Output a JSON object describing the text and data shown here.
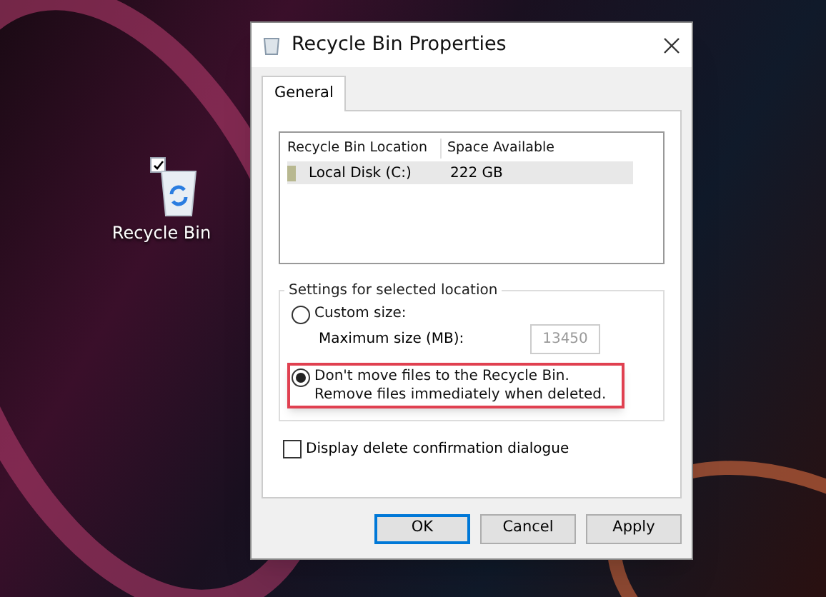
{
  "desktop_icon": {
    "label": "Recycle Bin",
    "checked": true
  },
  "window": {
    "title": "Recycle Bin Properties"
  },
  "tabs": [
    {
      "label": "General",
      "selected": true
    }
  ],
  "location_list": {
    "columns": [
      "Recycle Bin Location",
      "Space Available"
    ],
    "rows": [
      {
        "location": "Local Disk (C:)",
        "space": "222 GB",
        "selected": true
      }
    ]
  },
  "settings": {
    "title": "Settings for selected location",
    "options": [
      {
        "label": "Custom size:",
        "selected": false,
        "highlighted": false,
        "field": {
          "label": "Maximum size (MB):",
          "value": "13450",
          "disabled": true
        }
      },
      {
        "label": "Don't move files to the Recycle Bin. Remove files immediately when deleted.",
        "selected": true,
        "highlighted": true
      }
    ]
  },
  "confirm_checkbox": {
    "label": "Display delete confirmation dialogue",
    "checked": false
  },
  "buttons": [
    {
      "label": "OK",
      "default": true
    },
    {
      "label": "Cancel",
      "default": false
    },
    {
      "label": "Apply",
      "default": false
    }
  ]
}
